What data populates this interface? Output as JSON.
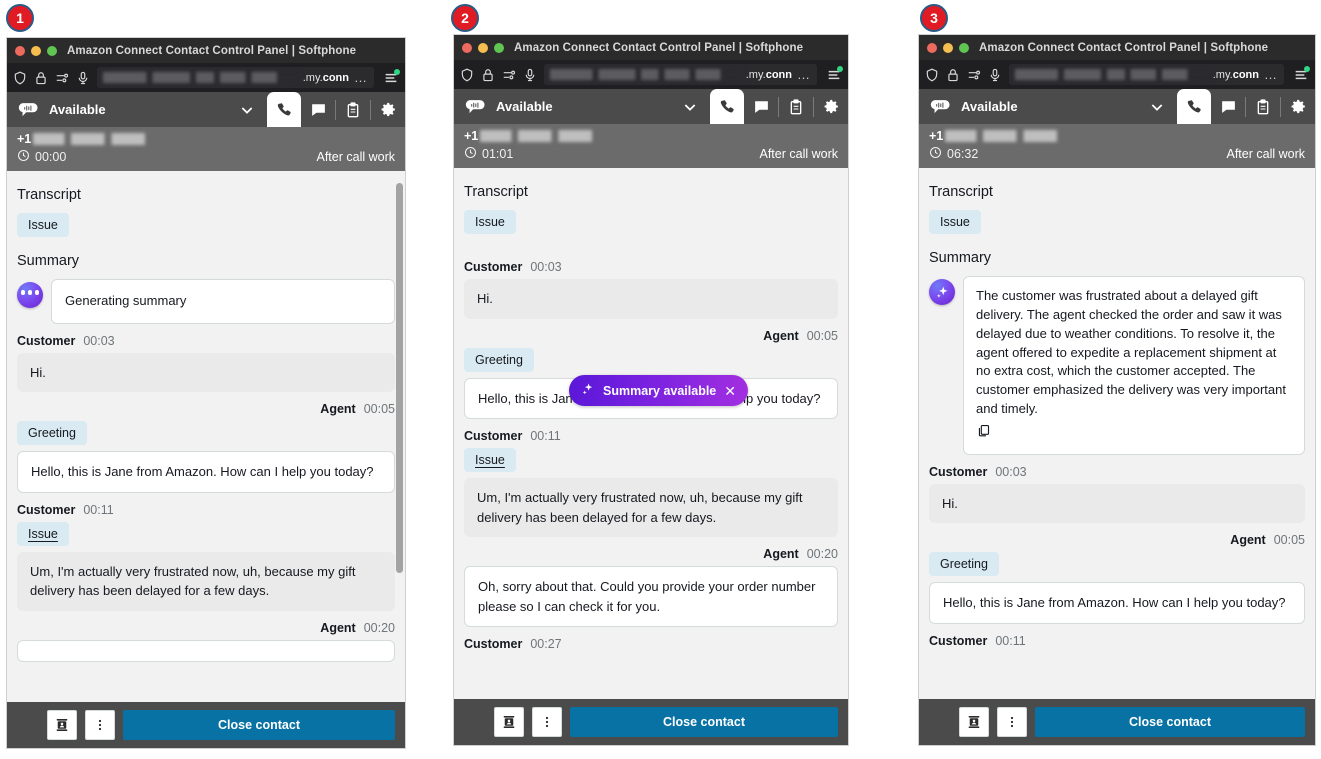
{
  "steps": [
    {
      "number": "1"
    },
    {
      "number": "2"
    },
    {
      "number": "3"
    }
  ],
  "window": {
    "title": "Amazon Connect Contact Control Panel | Softphone",
    "url_suffix": ".my.conn",
    "url_overflow": "…",
    "icons": {
      "shield": "shield-icon",
      "lock": "lock-icon",
      "sliders": "sliders-icon",
      "microphone": "microphone-icon",
      "menu": "hamburger-menu-icon"
    }
  },
  "ccp": {
    "status_label": "Available",
    "chevron": "chevron-down-icon",
    "tabs": [
      {
        "name": "phone",
        "icon": "phone-icon",
        "active": true
      },
      {
        "name": "chat",
        "icon": "chat-icon",
        "active": false
      },
      {
        "name": "tasks",
        "icon": "clipboard-icon",
        "active": false
      },
      {
        "name": "settings",
        "icon": "gear-icon",
        "active": false
      }
    ],
    "contact_prefix": "+1",
    "after_call_work": "After call work",
    "footer": {
      "contact_card_icon": "contact-card-icon",
      "more_icon": "more-vertical-icon",
      "close_label": "Close contact"
    }
  },
  "labels": {
    "transcript": "Transcript",
    "summary": "Summary",
    "issue": "Issue",
    "greeting": "Greeting",
    "customer": "Customer",
    "agent": "Agent"
  },
  "toast": {
    "label": "Summary available",
    "sparkle_icon": "sparkle-icon",
    "close_icon": "close-icon"
  },
  "panels": [
    {
      "id": "panel-1",
      "timer": "00:00",
      "summary_state": "Generating summary",
      "summary_visible": true,
      "toast_visible": false,
      "messages": [
        {
          "who": "Customer",
          "ts": "00:03",
          "side": "left",
          "tag": null,
          "text": "Hi."
        },
        {
          "who": "Agent",
          "ts": "00:05",
          "side": "right",
          "tag": "Greeting",
          "text": "Hello, this is Jane from Amazon. How can I help you today?"
        },
        {
          "who": "Customer",
          "ts": "00:11",
          "side": "left",
          "tag": "Issue",
          "text": "Um, I'm actually very frustrated now, uh, because my gift delivery has been delayed for a few days."
        },
        {
          "who": "Agent",
          "ts": "00:20",
          "side": "right",
          "tag": null,
          "text": ""
        }
      ]
    },
    {
      "id": "panel-2",
      "timer": "01:01",
      "summary_state": null,
      "summary_visible": false,
      "toast_visible": true,
      "messages": [
        {
          "who": "Customer",
          "ts": "00:03",
          "side": "left",
          "tag": null,
          "text": "Hi."
        },
        {
          "who": "Agent",
          "ts": "00:05",
          "side": "right",
          "tag": "Greeting",
          "text": "Hello, this is Jane from Amazon. How can I help you today?"
        },
        {
          "who": "Customer",
          "ts": "00:11",
          "side": "left",
          "tag": "Issue",
          "text": "Um, I'm actually very frustrated now, uh, because my gift delivery has been delayed for a few days."
        },
        {
          "who": "Agent",
          "ts": "00:20",
          "side": "right",
          "tag": null,
          "text": "Oh, sorry about that. Could you provide your order number please so I can check it for you."
        },
        {
          "who": "Customer",
          "ts": "00:27",
          "side": "left",
          "tag": null,
          "text": ""
        }
      ]
    },
    {
      "id": "panel-3",
      "timer": "06:32",
      "summary_state": "The customer was frustrated about a delayed gift delivery. The agent checked the order and saw it was delayed due to weather conditions. To resolve it, the agent offered to expedite a replacement shipment at no extra cost, which the customer accepted. The customer emphasized the delivery was very important and timely.",
      "summary_visible": true,
      "toast_visible": false,
      "messages": [
        {
          "who": "Customer",
          "ts": "00:03",
          "side": "left",
          "tag": null,
          "text": "Hi."
        },
        {
          "who": "Agent",
          "ts": "00:05",
          "side": "right",
          "tag": "Greeting",
          "text": "Hello, this is Jane from Amazon. How can I help you today?"
        },
        {
          "who": "Customer",
          "ts": "00:11",
          "side": "left",
          "tag": null,
          "text": ""
        }
      ]
    }
  ],
  "colors": {
    "accent_blue": "#0972a5",
    "tag_blue": "#d9eaf2",
    "toast_purple": "#7a22e0",
    "badge_red": "#e01b24",
    "chrome_dark": "#2b2b2b",
    "status_gray": "#4b4b4b"
  }
}
